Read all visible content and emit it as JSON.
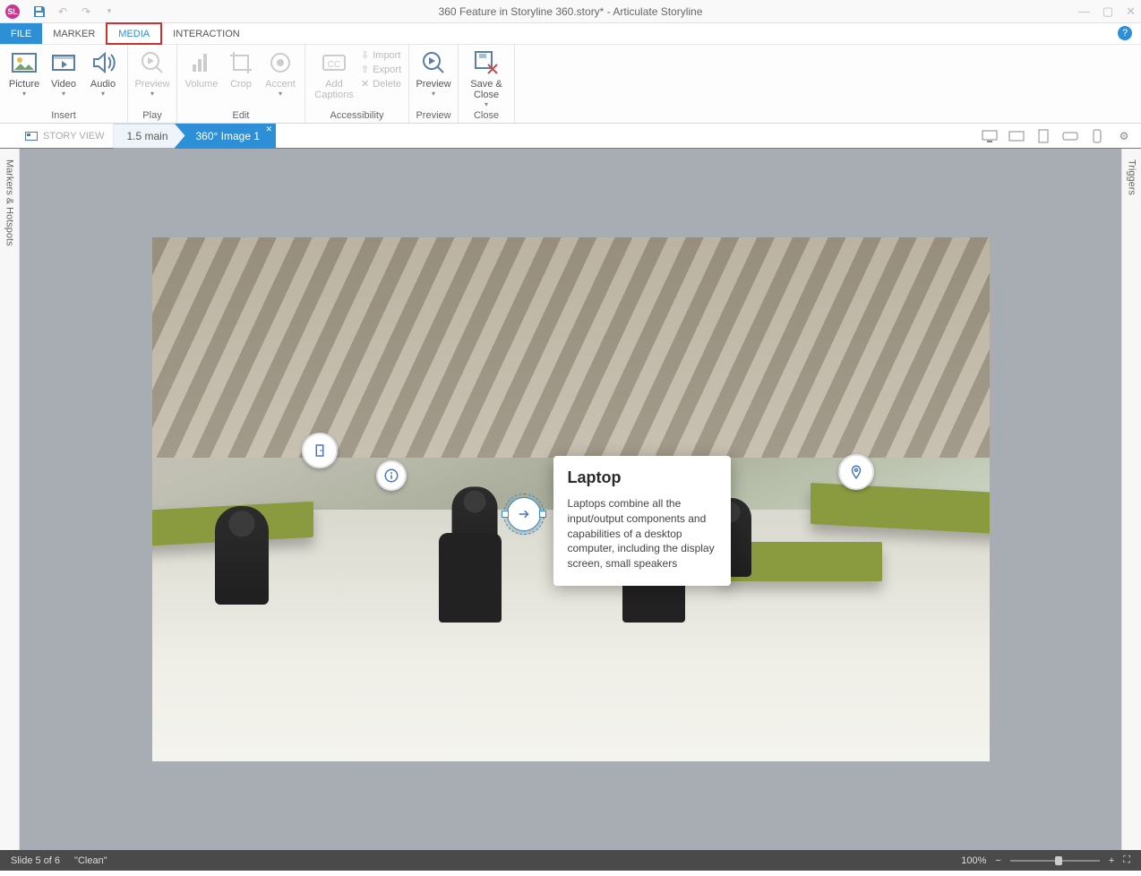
{
  "titlebar": {
    "title": "360 Feature in Storyline 360.story* -  Articulate Storyline"
  },
  "tabs": {
    "file": "FILE",
    "marker": "MARKER",
    "media": "MEDIA",
    "interaction": "INTERACTION"
  },
  "ribbon": {
    "insert": {
      "picture": "Picture",
      "video": "Video",
      "audio": "Audio",
      "group": "Insert"
    },
    "play": {
      "preview": "Preview",
      "group": "Play"
    },
    "edit": {
      "volume": "Volume",
      "crop": "Crop",
      "accent": "Accent",
      "group": "Edit"
    },
    "accessibility": {
      "addcaptions": "Add Captions",
      "import": "Import",
      "export": "Export",
      "delete": "Delete",
      "group": "Accessibility"
    },
    "preview": {
      "preview": "Preview",
      "group": "Preview"
    },
    "close": {
      "saveclose": "Save & Close",
      "group": "Close"
    }
  },
  "viewbar": {
    "storyview": "STORY VIEW",
    "crumb1": "1.5 main",
    "crumb2": "360° Image 1"
  },
  "panels": {
    "left": "Markers & Hotspots",
    "right": "Triggers"
  },
  "popup": {
    "title": "Laptop",
    "body": "Laptops combine all the input/output components and capabilities of a desktop computer, including the display screen, small speakers"
  },
  "status": {
    "slide": "Slide 5 of 6",
    "layout": "\"Clean\"",
    "zoom": "100%"
  }
}
